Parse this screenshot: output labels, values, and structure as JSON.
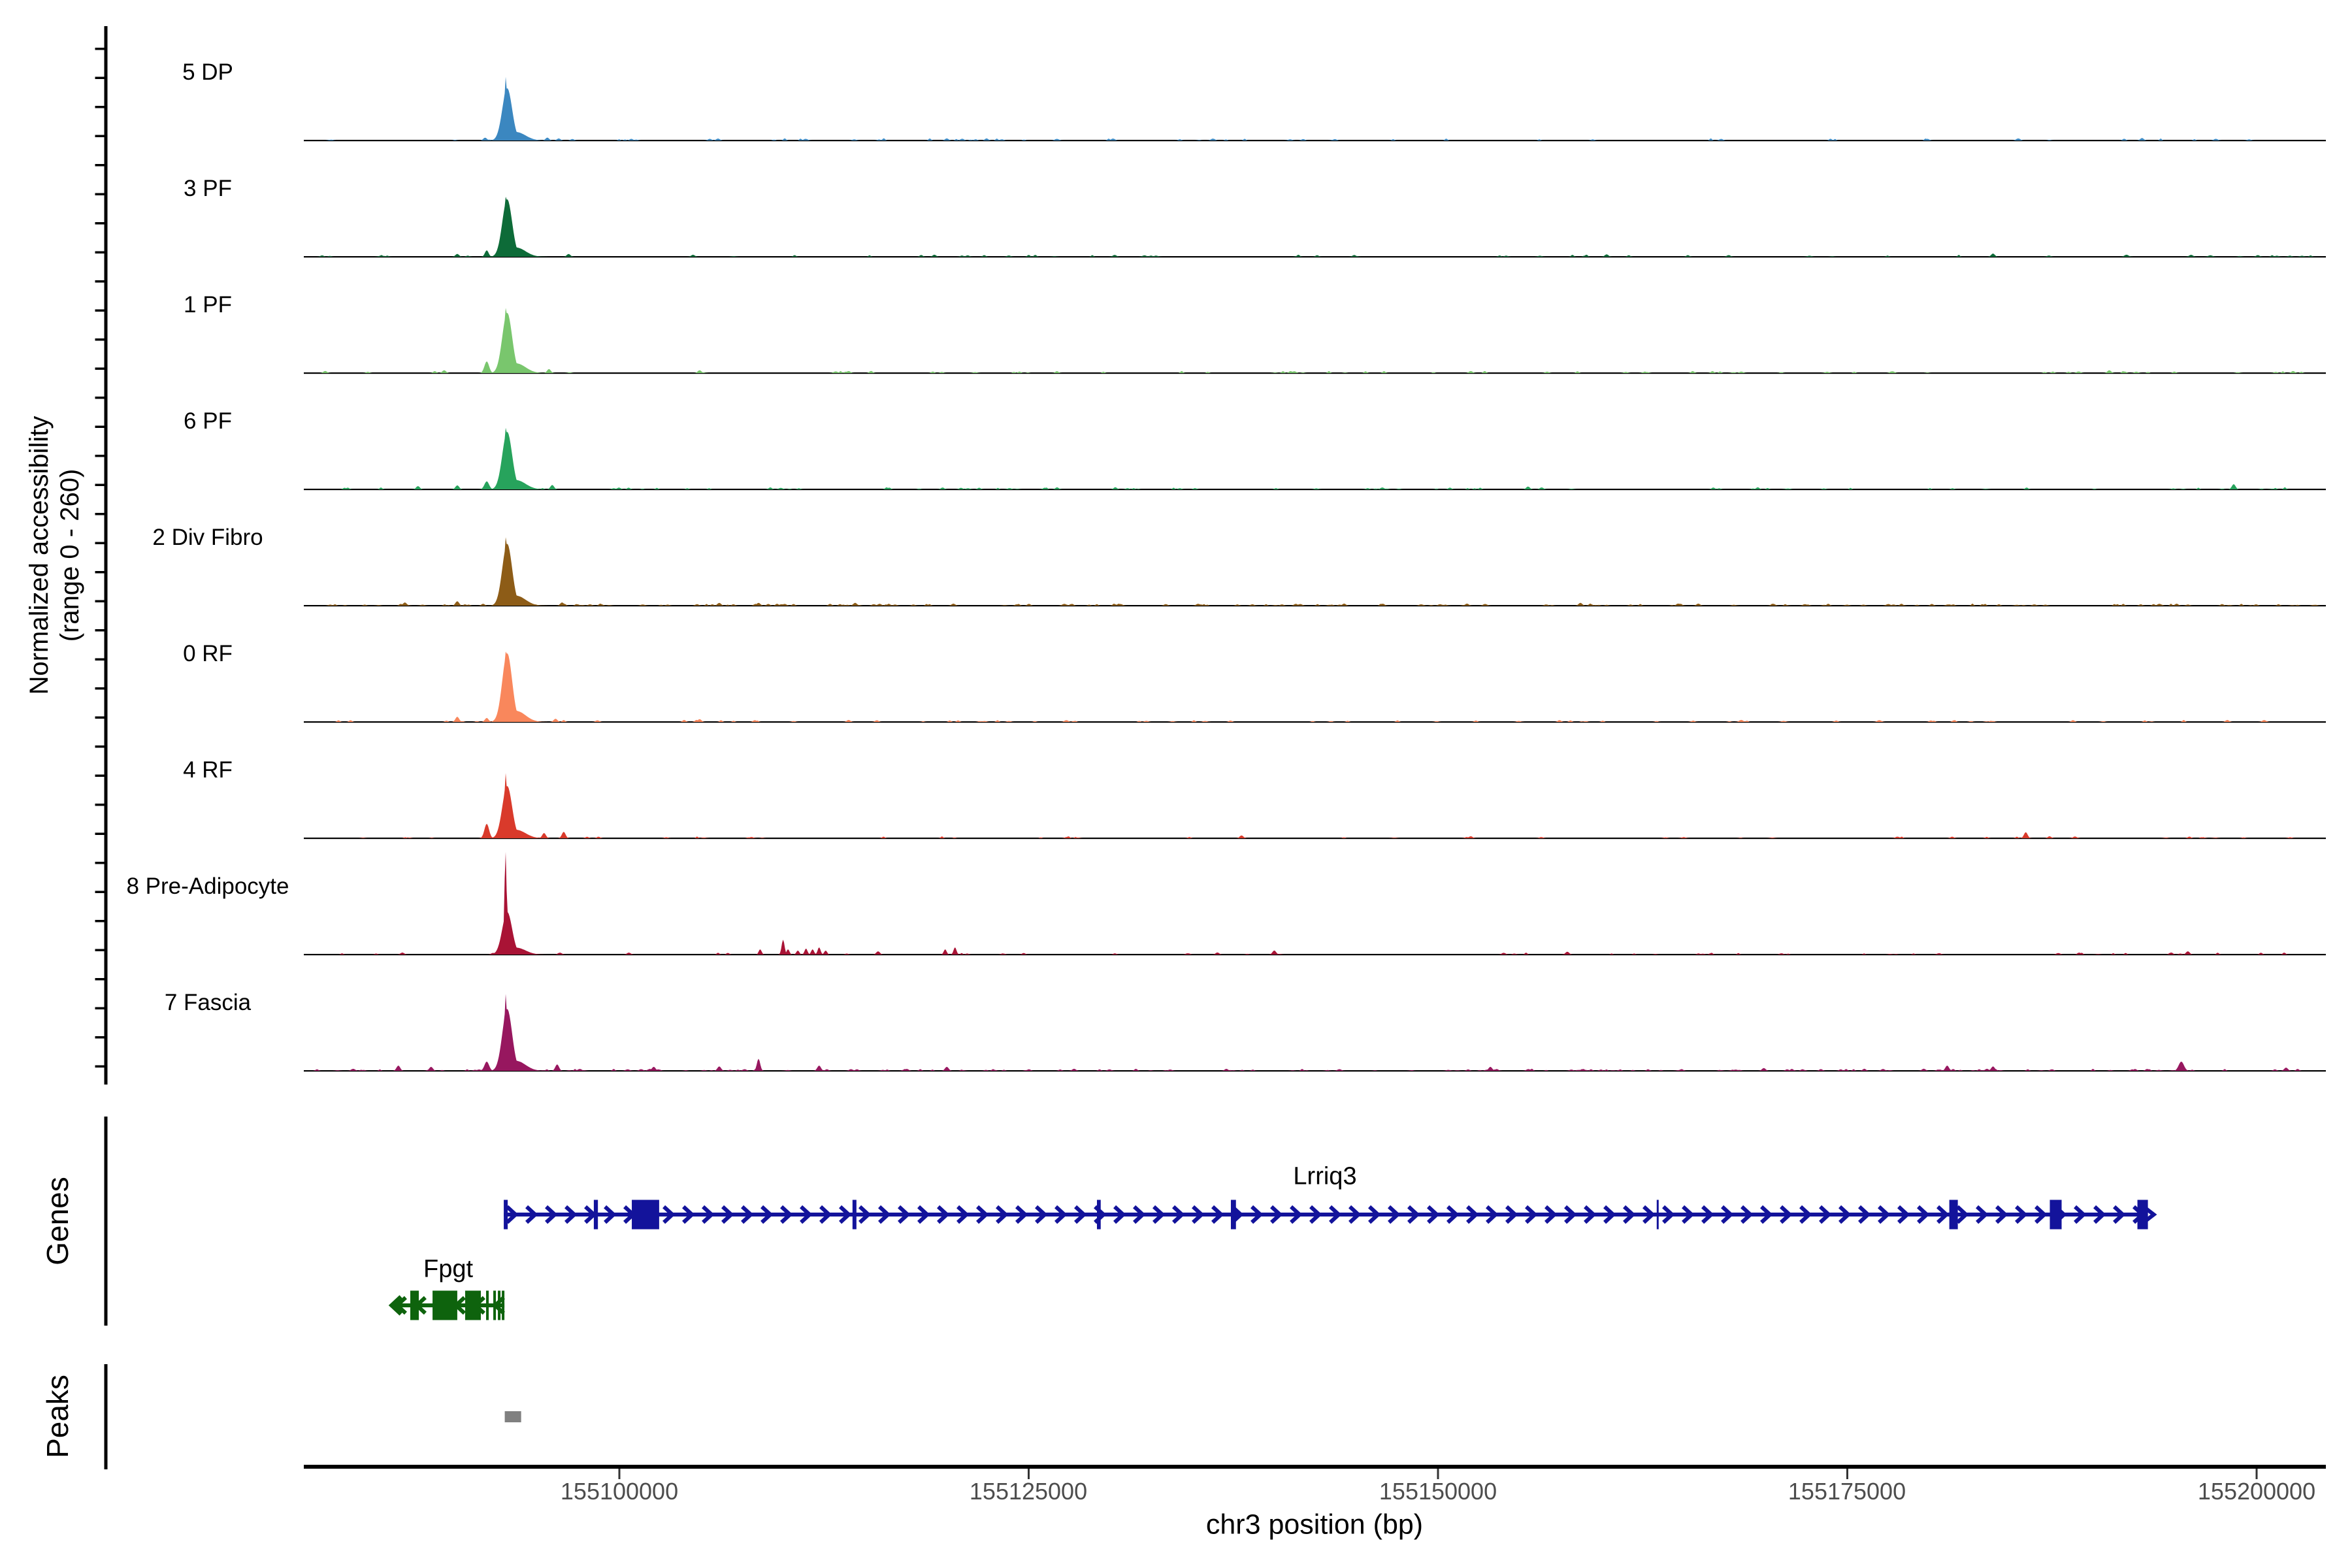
{
  "chart_data": {
    "type": "area",
    "subtype": "genome-browser-accessibility-tracks",
    "chrom": "chr3",
    "xlabel": "chr3 position (bp)",
    "ylabel": "Normalized accessibility",
    "y_range_label": "(range 0 - 260)",
    "ylim": [
      0,
      260
    ],
    "x_domain_bp": [
      155080700,
      155204300
    ],
    "x_ticks_bp": [
      155100000,
      155125000,
      155150000,
      155175000,
      155200000
    ],
    "x_tick_labels": [
      "155100000",
      "155125000",
      "155150000",
      "155175000",
      "155200000"
    ],
    "grid": false,
    "sections": {
      "genes_label": "Genes",
      "peaks_label": "Peaks"
    },
    "tracks": [
      {
        "label": "5 DP",
        "color": "#3b87c0",
        "peak": {
          "spike_bp": 155093050,
          "spike_value": 159,
          "body_bp": 155093150,
          "body_value": 130
        },
        "bumps": [
          [
            155091800,
            7
          ],
          [
            155095600,
            7
          ],
          [
            155096300,
            5
          ],
          [
            155120000,
            5
          ],
          [
            155179900,
            4
          ],
          [
            155193000,
            6
          ]
        ]
      },
      {
        "label": "3 PF",
        "color": "#0d6b38",
        "peak": {
          "spike_bp": 155093050,
          "spike_value": 150,
          "body_bp": 155093150,
          "body_value": 143
        },
        "bumps": [
          [
            155090100,
            7
          ],
          [
            155091900,
            16
          ],
          [
            155096900,
            7
          ],
          [
            155104500,
            5
          ],
          [
            155160300,
            6
          ],
          [
            155183900,
            8
          ]
        ]
      },
      {
        "label": "1 PF",
        "color": "#79c66d",
        "peak": {
          "spike_bp": 155093050,
          "spike_value": 163,
          "body_bp": 155093150,
          "body_value": 150
        },
        "bumps": [
          [
            155089300,
            7
          ],
          [
            155091900,
            29,
            3.5
          ],
          [
            155095700,
            10
          ],
          [
            155104900,
            7
          ],
          [
            155114000,
            5
          ],
          [
            155152000,
            5
          ],
          [
            155191000,
            7
          ]
        ]
      },
      {
        "label": "6 PF",
        "color": "#27a35c",
        "peak": {
          "spike_bp": 155093050,
          "spike_value": 154,
          "body_bp": 155093150,
          "body_value": 143
        },
        "bumps": [
          [
            155087700,
            8
          ],
          [
            155090100,
            10
          ],
          [
            155091900,
            20,
            3.5
          ],
          [
            155095900,
            11
          ],
          [
            155155500,
            7
          ],
          [
            155198600,
            13
          ]
        ]
      },
      {
        "label": "2 Div Fibro",
        "color": "#8d5c17",
        "peak": {
          "spike_bp": 155093050,
          "spike_value": 171,
          "body_bp": 155093150,
          "body_value": 154
        },
        "bumps": [
          [
            155086900,
            8
          ],
          [
            155090100,
            11
          ],
          [
            155096500,
            8
          ],
          [
            155106100,
            7
          ],
          [
            155108500,
            7
          ],
          [
            155114400,
            7
          ],
          [
            155120400,
            5
          ],
          [
            155158700,
            7
          ],
          [
            155165900,
            5
          ]
        ]
      },
      {
        "label": "0 RF",
        "color": "#f9875c",
        "peak": {
          "spike_bp": 155093050,
          "spike_value": 176,
          "body_bp": 155093150,
          "body_value": 171
        },
        "bumps": [
          [
            155090100,
            13
          ],
          [
            155091900,
            10
          ],
          [
            155096100,
            8
          ],
          [
            155104900,
            7
          ],
          [
            155114000,
            5
          ]
        ]
      },
      {
        "label": "4 RF",
        "color": "#d93a2b",
        "peak": {
          "spike_bp": 155093050,
          "spike_value": 163,
          "body_bp": 155093150,
          "body_value": 130
        },
        "bumps": [
          [
            155091900,
            36,
            3.5
          ],
          [
            155095400,
            13
          ],
          [
            155096600,
            16
          ],
          [
            155138000,
            7
          ],
          [
            155152000,
            5
          ],
          [
            155185900,
            15
          ]
        ]
      },
      {
        "label": "8 Pre-Adipocyte",
        "color": "#a91335",
        "peak": {
          "spike_bp": 155093050,
          "spike_value": 257,
          "body_bp": 155093150,
          "body_value": 106
        },
        "bumps": [
          [
            155108600,
            13,
            2.2
          ],
          [
            155110000,
            37,
            2.2
          ],
          [
            155110300,
            13,
            2.2
          ],
          [
            155110900,
            10,
            2.2
          ],
          [
            155111400,
            15,
            2.2
          ],
          [
            155111800,
            13,
            2.2
          ],
          [
            155112200,
            18,
            2.2
          ],
          [
            155112600,
            10,
            2.2
          ],
          [
            155115800,
            8
          ],
          [
            155119900,
            13,
            2.2
          ],
          [
            155120500,
            18,
            2.2
          ],
          [
            155140000,
            10
          ],
          [
            155157900,
            7
          ],
          [
            155195800,
            8
          ]
        ]
      },
      {
        "label": "7 Fascia",
        "color": "#97175f",
        "peak": {
          "spike_bp": 155093050,
          "spike_value": 192,
          "body_bp": 155093150,
          "body_value": 154
        },
        "bumps": [
          [
            155086500,
            13
          ],
          [
            155088500,
            10
          ],
          [
            155091900,
            23,
            3.5
          ],
          [
            155096200,
            16
          ],
          [
            155102100,
            10
          ],
          [
            155106100,
            11
          ],
          [
            155108500,
            30,
            2.5
          ],
          [
            155112200,
            13
          ],
          [
            155120000,
            10
          ],
          [
            155153200,
            10
          ],
          [
            155169900,
            7
          ],
          [
            155181100,
            13
          ],
          [
            155183900,
            11
          ],
          [
            155195400,
            23,
            4
          ],
          [
            155201800,
            8
          ]
        ]
      }
    ],
    "genes": [
      {
        "name": "Lrriq3",
        "strand": "+",
        "row": 0,
        "color": "#13139b",
        "start_bp": 155092940,
        "end_bp": 155193360,
        "exons": [
          [
            155092940,
            155093180
          ],
          [
            155098440,
            155098690
          ],
          [
            155100760,
            155102430
          ],
          [
            155114240,
            155114480
          ],
          [
            155129170,
            155129400
          ],
          [
            155137350,
            155137660
          ],
          [
            155163360,
            155163480
          ],
          [
            155181230,
            155181750
          ],
          [
            155187370,
            155188090
          ],
          [
            155192720,
            155193360
          ]
        ]
      },
      {
        "name": "Fpgt",
        "strand": "-",
        "row": 1,
        "color": "#0e630d",
        "start_bp": 155086030,
        "end_bp": 155092980,
        "exons": [
          [
            155087230,
            155087750
          ],
          [
            155088590,
            155090100
          ],
          [
            155090580,
            155091540
          ],
          [
            155091860,
            155092020
          ],
          [
            155092300,
            155092460
          ],
          [
            155092580,
            155092740
          ],
          [
            155092820,
            155092980
          ]
        ]
      }
    ],
    "peaks": [
      {
        "start_bp": 155093000,
        "end_bp": 155094000
      }
    ],
    "peak_color": "#808080",
    "tick_label_color": "#4d4d4d"
  }
}
